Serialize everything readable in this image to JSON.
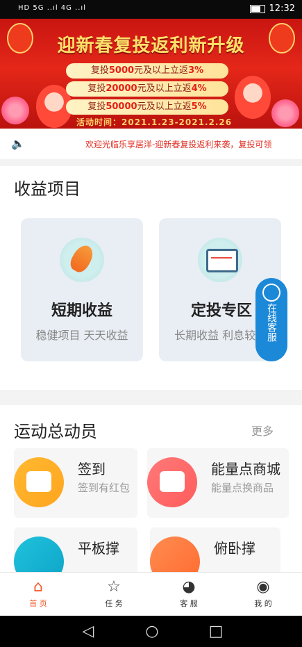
{
  "status_bar": {
    "left": "HD 5G ..ıl 4G ..ıl",
    "time": "12:32"
  },
  "banner": {
    "title": "迎新春复投返利新升级",
    "offers": [
      {
        "text": "复投",
        "amount": "5000",
        "suffix": "元及以上立返",
        "rate": "3%"
      },
      {
        "text": "复投",
        "amount": "20000",
        "suffix": "元及以上立返",
        "rate": "4%"
      },
      {
        "text": "复投",
        "amount": "50000",
        "suffix": "元及以上立返",
        "rate": "5%"
      }
    ],
    "activity_time": "活动时间：2021.1.23-2021.2.26"
  },
  "notice": {
    "text": "欢迎光临乐享居洋-迎新春复投返利来袭，复投可领"
  },
  "earnings": {
    "title": "收益项目",
    "cards": [
      {
        "title": "短期收益",
        "subtitle": "稳健项目 天天收益"
      },
      {
        "title": "定投专区",
        "subtitle": "长期收益 利息较"
      }
    ]
  },
  "service_float": {
    "label": "在线客服"
  },
  "sports": {
    "title": "运动总动员",
    "more": "更多",
    "items": [
      {
        "title": "签到",
        "subtitle": "签到有红包"
      },
      {
        "title": "能量点商城",
        "subtitle": "能量点换商品"
      },
      {
        "title": "平板撑",
        "subtitle": ""
      },
      {
        "title": "俯卧撑",
        "subtitle": ""
      }
    ]
  },
  "tabs": [
    {
      "label": "首 页"
    },
    {
      "label": "任 务"
    },
    {
      "label": "客 服"
    },
    {
      "label": "我 的"
    }
  ],
  "colors": {
    "accent": "#f05a2a",
    "banner_red": "#e42719",
    "service_blue": "#1c88d8"
  }
}
